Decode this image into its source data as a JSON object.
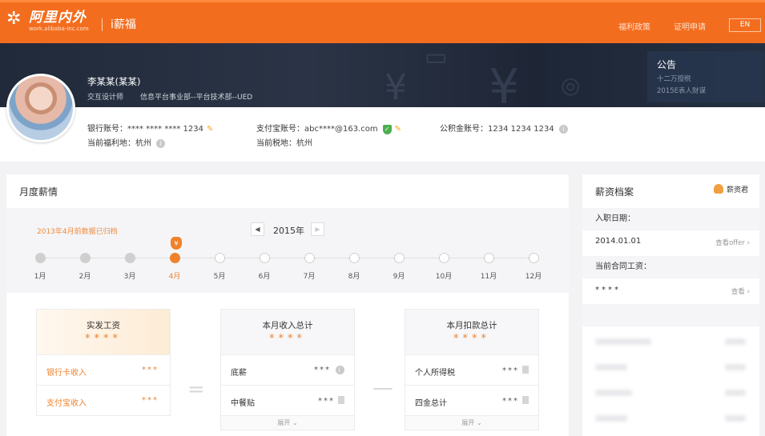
{
  "header": {
    "logo_name": "阿里内外",
    "logo_url": "work.alibaba-inc.com",
    "app_name": "i薪福",
    "nav": [
      "福利政策",
      "证明申请"
    ],
    "lang": "EN"
  },
  "banner": {
    "user_name": "李某某(某某)",
    "user_title": "交互设计师",
    "user_dept": "信息平台事业部--平台技术部--UED",
    "notice": {
      "title": "公告",
      "lines": [
        "十二万授税",
        "2015E表人財谋"
      ]
    }
  },
  "info": {
    "bank_label": "银行账号：",
    "bank_value": "**** **** **** 1234",
    "welfare_label": "当前福利地：",
    "welfare_value": "杭州",
    "alipay_label": "支付宝账号：",
    "alipay_value": "abc****@163.com",
    "tax_label": "当前税地：",
    "tax_value": "杭州",
    "fund_label": "公积金账号：",
    "fund_value": "1234 1234 1234"
  },
  "monthly": {
    "title": "月度薪情",
    "archived_note": "2013年4月前数据已归档",
    "year": "2015年",
    "months": [
      "1月",
      "2月",
      "3月",
      "4月",
      "5月",
      "6月",
      "7月",
      "8月",
      "9月",
      "10月",
      "11月",
      "12月"
    ],
    "current_month_index": 3
  },
  "cards": {
    "actual": {
      "title": "实发工资",
      "stars": "****",
      "rows": [
        {
          "label": "银行卡收入",
          "value": "***"
        },
        {
          "label": "支付宝收入",
          "value": "***"
        }
      ]
    },
    "income": {
      "title": "本月收入总计",
      "stars": "****",
      "rows": [
        {
          "label": "底薪",
          "value": "***"
        },
        {
          "label": "中餐贴",
          "value": "***"
        }
      ],
      "expand": "展开"
    },
    "deduction": {
      "title": "本月扣款总计",
      "stars": "****",
      "rows": [
        {
          "label": "个人所得税",
          "value": "***"
        },
        {
          "label": "四金总计",
          "value": "***"
        }
      ],
      "expand": "展开"
    },
    "op_equals": "=",
    "op_minus": "—"
  },
  "profile": {
    "title": "薪资档案",
    "user_label": "薪资君",
    "hire_label": "入职日期：",
    "hire_date": "2014.01.01",
    "hire_link": "查看offer",
    "contract_label": "当前合同工资：",
    "contract_value": "****",
    "contract_link": "查看"
  }
}
